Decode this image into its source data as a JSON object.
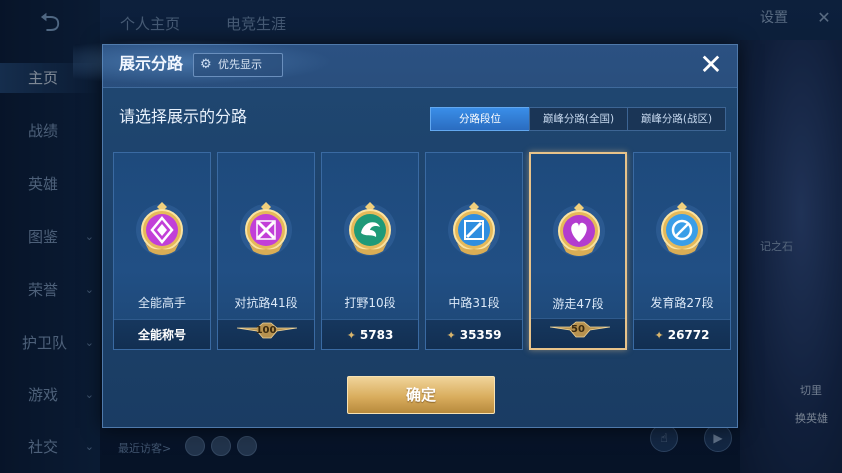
{
  "background": {
    "top_tabs": [
      "个人主页",
      "电竞生涯"
    ],
    "settings_label": "设置",
    "sidebar_items": [
      "主页",
      "战绩",
      "英雄",
      "图鉴",
      "荣誉",
      "护卫队",
      "游戏",
      "社交"
    ],
    "recent_visitors_label": "最近访客>",
    "deco_text": "记之石",
    "deco_text_2": "换英雄",
    "deco_text_3": "切里"
  },
  "modal": {
    "title": "展示分路",
    "priority_label": "优先显示",
    "close_icon": "close-icon",
    "prompt": "请选择展示的分路",
    "tabs": [
      {
        "label": "分路段位",
        "active": true
      },
      {
        "label": "巅峰分路(全国)",
        "active": false
      },
      {
        "label": "巅峰分路(战区)",
        "active": false
      }
    ],
    "cards": [
      {
        "name": "全能高手",
        "footer": "全能称号",
        "footer_icon": "",
        "tier_mark": "",
        "badge_color": "#c23fd8",
        "badge_glyph": "diamond",
        "selected": false
      },
      {
        "name": "对抗路41段",
        "footer": "",
        "footer_icon": "",
        "tier_mark": "100",
        "badge_color": "#c23fd8",
        "badge_glyph": "cross",
        "selected": false
      },
      {
        "name": "打野10段",
        "footer": "5783",
        "footer_icon": "rank-icon",
        "tier_mark": "",
        "badge_color": "#1f9a78",
        "badge_glyph": "dragon",
        "selected": false
      },
      {
        "name": "中路31段",
        "footer": "35359",
        "footer_icon": "rank-icon",
        "tier_mark": "",
        "badge_color": "#2f8ee0",
        "badge_glyph": "slash",
        "selected": false
      },
      {
        "name": "游走47段",
        "footer": "",
        "footer_icon": "",
        "tier_mark": "50",
        "badge_color": "#b33ccf",
        "badge_glyph": "heart",
        "selected": true
      },
      {
        "name": "发育路27段",
        "footer": "26772",
        "footer_icon": "rank-icon",
        "tier_mark": "",
        "badge_color": "#3a9ee8",
        "badge_glyph": "target",
        "selected": false
      }
    ],
    "confirm_label": "确定"
  }
}
